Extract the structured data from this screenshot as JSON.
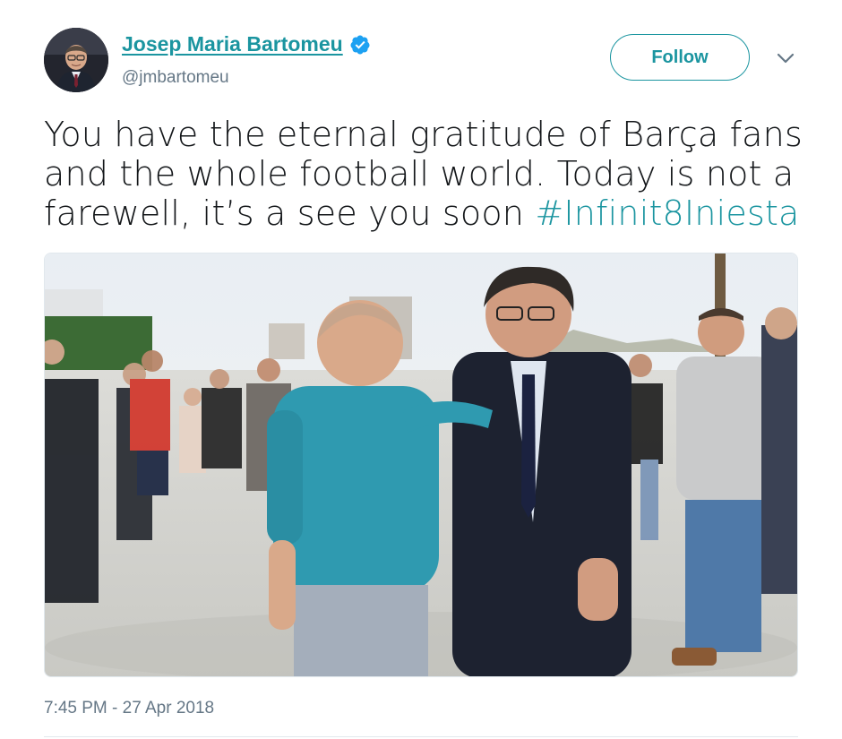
{
  "author": {
    "display_name": "Josep Maria Bartomeu",
    "handle": "@jmbartomeu",
    "verified": true
  },
  "follow_button": {
    "label": "Follow"
  },
  "tweet": {
    "text": "You have the eternal gratitude of Barça fans and the whole football world. Today is not a farewell, it’s a see you soon ",
    "hashtag": "#Infinit8Iniesta",
    "timestamp": "7:45 PM - 27 Apr 2018"
  },
  "colors": {
    "accent": "#1b95a0",
    "verified": "#1da1f2",
    "secondary_text": "#657786",
    "primary_text": "#14171a"
  },
  "icons": {
    "verified": "verified-badge-icon",
    "caret": "chevron-down-icon"
  }
}
